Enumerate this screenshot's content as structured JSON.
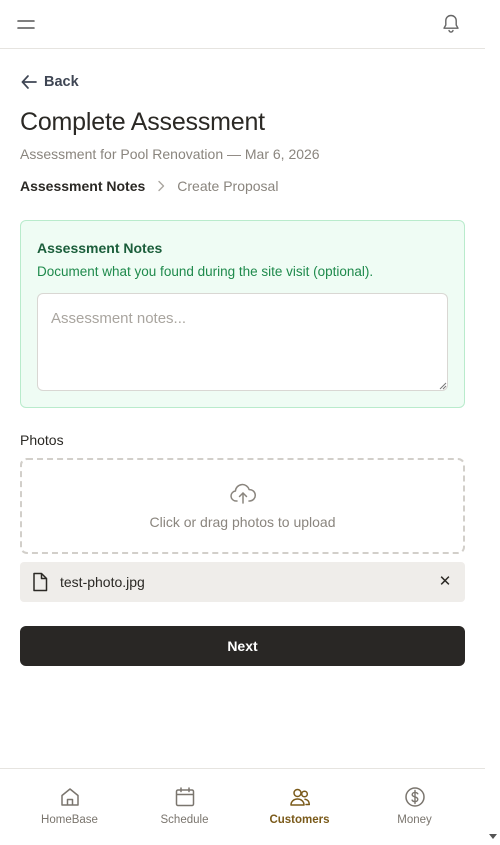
{
  "header": {
    "menu_icon": "menu-icon",
    "bell_icon": "bell-icon"
  },
  "back": {
    "label": "Back",
    "icon": "arrow-left-icon"
  },
  "page": {
    "title": "Complete Assessment",
    "subtitle": "Assessment for Pool Renovation — Mar 6, 2026"
  },
  "steps": {
    "active": "Assessment Notes",
    "inactive": "Create Proposal"
  },
  "notes": {
    "title": "Assessment Notes",
    "description": "Document what you found during the site visit (optional).",
    "placeholder": "Assessment notes...",
    "value": ""
  },
  "photos": {
    "label": "Photos",
    "dropzone_text": "Click or drag photos to upload",
    "files": [
      {
        "name": "test-photo.jpg",
        "remove_label": "✕"
      }
    ]
  },
  "next_button": {
    "label": "Next"
  },
  "bottom_nav": {
    "items": [
      {
        "label": "HomeBase",
        "icon": "home-icon",
        "active": false
      },
      {
        "label": "Schedule",
        "icon": "calendar-icon",
        "active": false
      },
      {
        "label": "Customers",
        "icon": "users-icon",
        "active": true
      },
      {
        "label": "Money",
        "icon": "dollar-icon",
        "active": false
      }
    ]
  },
  "colors": {
    "accent_green_bg": "#effcf4",
    "accent_green_text": "#1f8a4c",
    "active_nav": "#7a5a1a",
    "primary_button": "#292725"
  }
}
